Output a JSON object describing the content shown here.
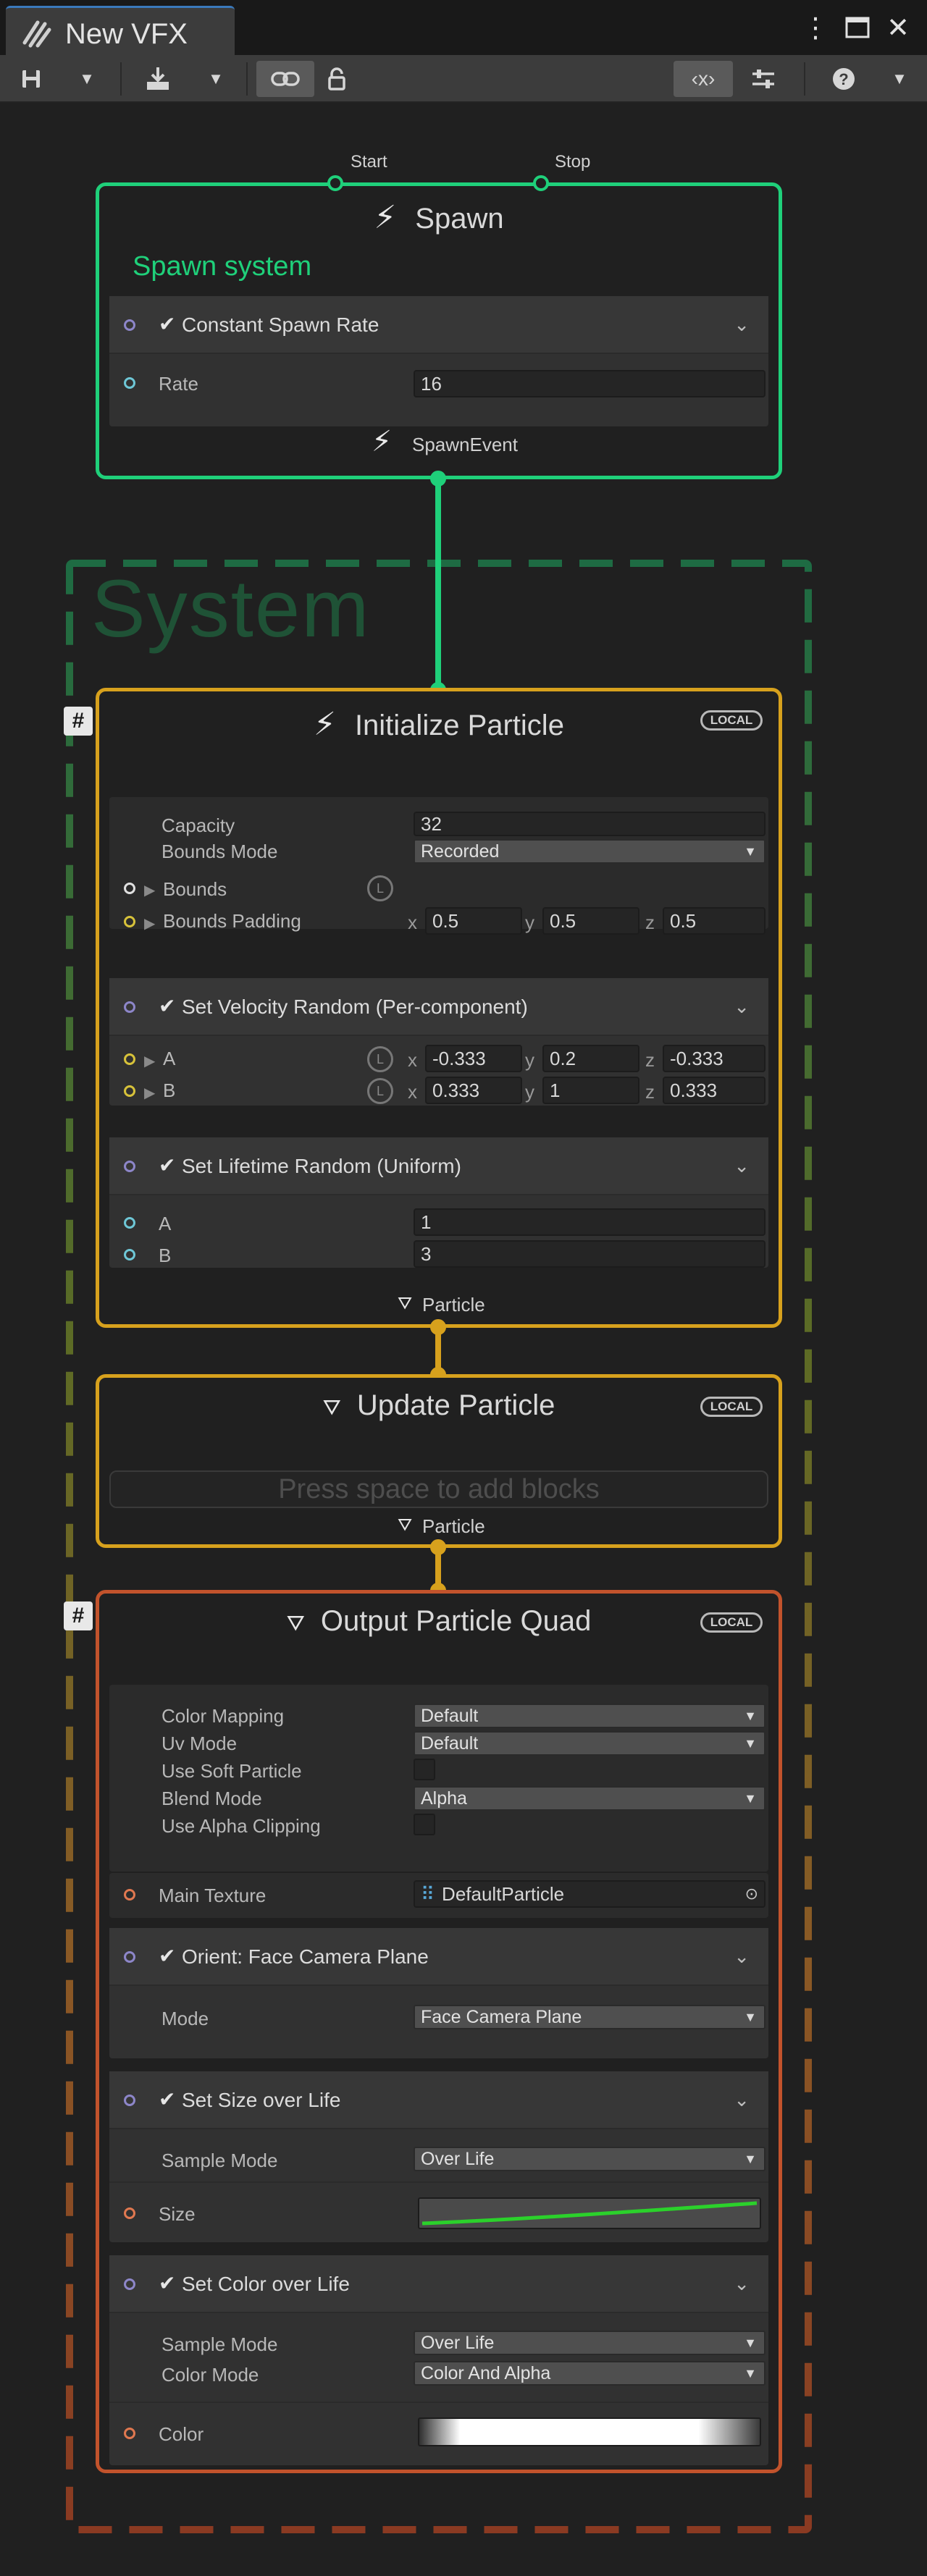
{
  "window": {
    "tab_title": "New VFX",
    "icons": [
      "vfx-graph-icon",
      "more-vert-icon",
      "maximize-icon",
      "close-icon"
    ]
  },
  "toolbar": {
    "icons": [
      "save-icon",
      "save-dropdown-icon",
      "import-icon",
      "import-dropdown-icon",
      "link-icon",
      "lock-icon",
      "blackboard-icon",
      "inspector-icon",
      "help-icon",
      "menu-dropdown-icon"
    ]
  },
  "graph": {
    "system_label": "System",
    "spawn": {
      "title": "Spawn",
      "subtitle": "Spawn system",
      "port_start": "Start",
      "port_stop": "Stop",
      "output_label": "SpawnEvent",
      "block_title": "Constant Spawn Rate",
      "rate_label": "Rate",
      "rate_value": "16"
    },
    "initialize": {
      "title": "Initialize Particle",
      "badge": "LOCAL",
      "capacity_label": "Capacity",
      "capacity_value": "32",
      "bounds_mode_label": "Bounds Mode",
      "bounds_mode_value": "Recorded",
      "bounds_label": "Bounds",
      "bounds_padding_label": "Bounds Padding",
      "padding": {
        "x": "0.5",
        "y": "0.5",
        "z": "0.5"
      },
      "velocity_block": {
        "title": "Set Velocity Random (Per-component)",
        "a_label": "A",
        "a": {
          "x": "-0.333",
          "y": "0.2",
          "z": "-0.333"
        },
        "b_label": "B",
        "b": {
          "x": "0.333",
          "y": "1",
          "z": "0.333"
        }
      },
      "lifetime_block": {
        "title": "Set Lifetime Random (Uniform)",
        "a_label": "A",
        "a_value": "1",
        "b_label": "B",
        "b_value": "3"
      },
      "output_label": "Particle"
    },
    "update": {
      "title": "Update Particle",
      "badge": "LOCAL",
      "placeholder": "Press space to add blocks",
      "output_label": "Particle"
    },
    "output": {
      "title": "Output Particle Quad",
      "badge": "LOCAL",
      "color_mapping_label": "Color Mapping",
      "color_mapping_value": "Default",
      "uv_mode_label": "Uv Mode",
      "uv_mode_value": "Default",
      "soft_particle_label": "Use Soft Particle",
      "blend_mode_label": "Blend Mode",
      "blend_mode_value": "Alpha",
      "alpha_clipping_label": "Use Alpha Clipping",
      "main_texture_label": "Main Texture",
      "main_texture_value": "DefaultParticle",
      "orient_block": {
        "title": "Orient: Face Camera Plane",
        "mode_label": "Mode",
        "mode_value": "Face Camera Plane"
      },
      "size_block": {
        "title": "Set Size over Life",
        "sample_mode_label": "Sample Mode",
        "sample_mode_value": "Over Life",
        "size_label": "Size"
      },
      "color_block": {
        "title": "Set Color over Life",
        "sample_mode_label": "Sample Mode",
        "sample_mode_value": "Over Life",
        "color_mode_label": "Color Mode",
        "color_mode_value": "Color And Alpha",
        "color_label": "Color"
      }
    },
    "colors": {
      "spawn": "#1fd07a",
      "init": "#d7a11d",
      "output": "#c2532c",
      "frame": "#1e6b43"
    }
  }
}
